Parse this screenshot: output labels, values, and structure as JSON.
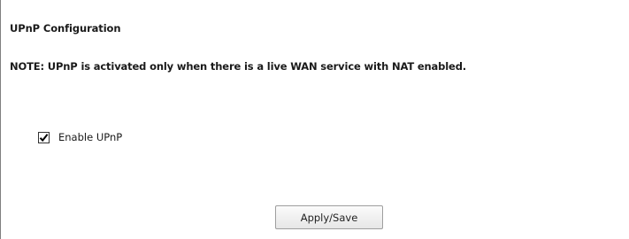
{
  "page": {
    "title": "UPnP Configuration",
    "note": "NOTE: UPnP is activated only when there is a live WAN service with NAT enabled."
  },
  "form": {
    "enable_upnp": {
      "label": "Enable UPnP",
      "checked": true,
      "check_icon": "checkmark-icon"
    },
    "apply_button_label": "Apply/Save"
  }
}
